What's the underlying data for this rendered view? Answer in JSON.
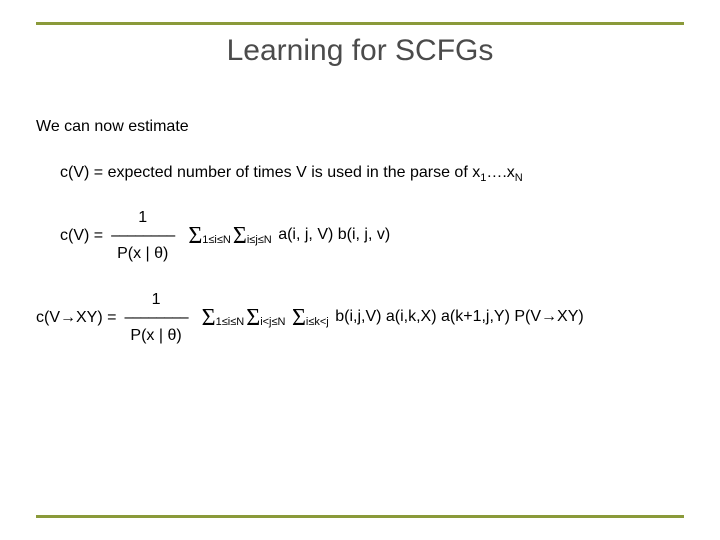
{
  "title": "Learning for SCFGs",
  "lead": "We can now estimate",
  "def": {
    "prefix": "c(V) = expected number of times V is used in the parse of x",
    "sub1": "1",
    "mid": "….x",
    "sub2": "N"
  },
  "eq1": {
    "lhs": "c(V) = ",
    "num": "1",
    "line": "––––––––",
    "den": "P(x | θ)",
    "sum1_sub": "1≤i≤N",
    "sum2_sub": "i≤j≤N",
    "rhs": " a(i, j, V) b(i, j, v)"
  },
  "eq2": {
    "lhs": "c(V→XY) = ",
    "num": "1",
    "line": "––––––––",
    "den": "P(x | θ)",
    "sum1_sub": "1≤i≤N",
    "sum2_sub": "i<j≤N",
    "sum3_sub": "i≤k<j",
    "rhs": " b(i,j,V) a(i,k,X) a(k+1,j,Y) P(V→XY)"
  },
  "sigma": "Σ"
}
